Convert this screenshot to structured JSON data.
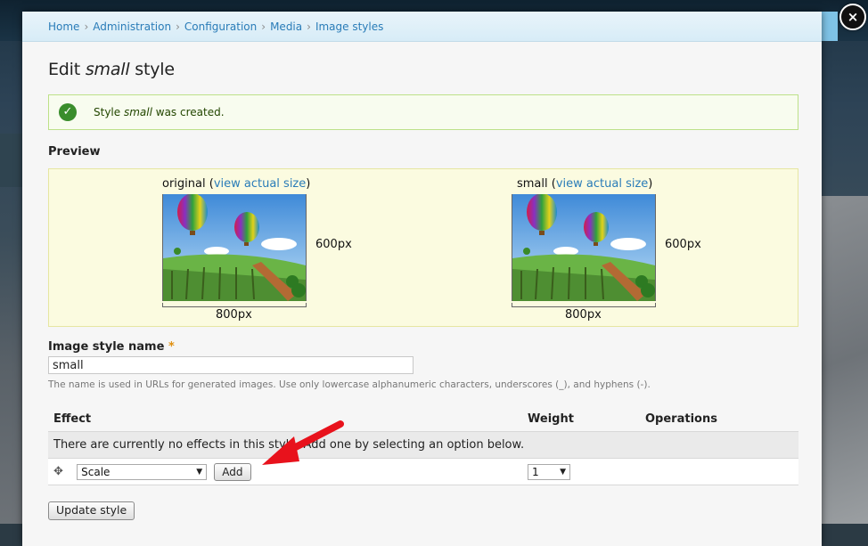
{
  "breadcrumb": {
    "items": [
      "Home",
      "Administration",
      "Configuration",
      "Media",
      "Image styles"
    ],
    "separator": "›"
  },
  "page": {
    "title_prefix": "Edit ",
    "title_name": "small",
    "title_suffix": " style"
  },
  "status": {
    "prefix": "Style ",
    "name": "small",
    "suffix": " was created."
  },
  "preview": {
    "label": "Preview",
    "original": {
      "caption": "original",
      "link": "view actual size",
      "width_label": "800px",
      "height_label": "600px"
    },
    "small": {
      "caption": "small",
      "link": "view actual size",
      "width_label": "800px",
      "height_label": "600px"
    }
  },
  "form": {
    "name_label": "Image style name",
    "required_mark": "*",
    "name_value": "small",
    "name_description": "The name is used in URLs for generated images. Use only lowercase alphanumeric characters, underscores (_), and hyphens (-)."
  },
  "effects_table": {
    "headers": [
      "Effect",
      "Weight",
      "Operations"
    ],
    "empty_message": "There are currently no effects in this style. Add one by selecting an option below.",
    "new_effect_value": "Scale",
    "add_label": "Add",
    "weight_value": "1"
  },
  "actions": {
    "update_label": "Update style"
  },
  "window": {
    "close_symbol": "×"
  },
  "colors": {
    "accent_link": "#2a7cb8",
    "status_border": "#bde189",
    "arrow": "#e8121c"
  }
}
